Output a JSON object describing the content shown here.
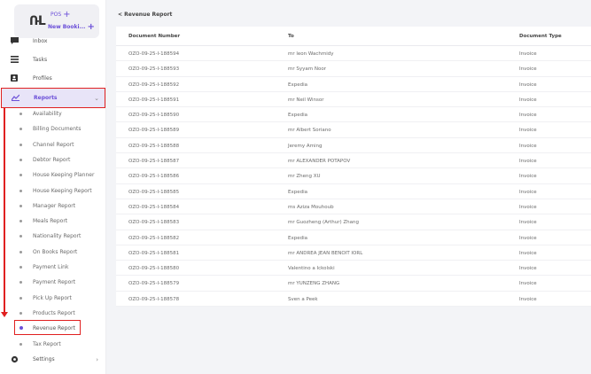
{
  "brand": {
    "logo": "ՌL",
    "line1": "POS",
    "line2": "New Booki..."
  },
  "sidebar": {
    "items": [
      {
        "label": "Inbox"
      },
      {
        "label": "Tasks"
      },
      {
        "label": "Profiles"
      },
      {
        "label": "Reports"
      }
    ],
    "reports_sub": [
      "Availability",
      "Billing Documents",
      "Channel Report",
      "Debtor Report",
      "House Keeping Planner",
      "House Keeping Report",
      "Manager Report",
      "Meals Report",
      "Nationality Report",
      "On Books Report",
      "Payment Link",
      "Payment Report",
      "Pick Up Report",
      "Products Report",
      "Revenue Report",
      "Tax Report"
    ],
    "settings": "Settings"
  },
  "main": {
    "breadcrumb": "< Revenue Report",
    "columns": [
      "Document Number",
      "To",
      "Document Type"
    ],
    "rows": [
      [
        "OZO-09-25-I-188594",
        "mr leon Wachmidy",
        "Invoice"
      ],
      [
        "OZO-09-25-I-188593",
        "mr Syyam Noor",
        "Invoice"
      ],
      [
        "OZO-09-25-I-188592",
        "Expedia",
        "Invoice"
      ],
      [
        "OZO-09-25-I-188591",
        "mr Neil Winsor",
        "Invoice"
      ],
      [
        "OZO-09-25-I-188590",
        "Expedia",
        "Invoice"
      ],
      [
        "OZO-09-25-I-188589",
        "mr Albert Soriano",
        "Invoice"
      ],
      [
        "OZO-09-25-I-188588",
        "Jeremy Aming",
        "Invoice"
      ],
      [
        "OZO-09-25-I-188587",
        "mr ALEXANDER POTAPOV",
        "Invoice"
      ],
      [
        "OZO-09-25-I-188586",
        "mr Zheng XU",
        "Invoice"
      ],
      [
        "OZO-09-25-I-188585",
        "Expedia",
        "Invoice"
      ],
      [
        "OZO-09-25-I-188584",
        "ms Aziza Mouhoub",
        "Invoice"
      ],
      [
        "OZO-09-25-I-188583",
        "mr Guozheng (Arthur) Zhang",
        "Invoice"
      ],
      [
        "OZO-09-25-I-188582",
        "Expedia",
        "Invoice"
      ],
      [
        "OZO-09-25-I-188581",
        "mr ANDREA JEAN BENOIT IORL",
        "Invoice"
      ],
      [
        "OZO-09-25-I-188580",
        "Valentino a Ickolski",
        "Invoice"
      ],
      [
        "OZO-09-25-I-188579",
        "mr YUNZENG ZHANG",
        "Invoice"
      ],
      [
        "OZO-09-25-I-188578",
        "Sven a Peek",
        "Invoice"
      ]
    ]
  },
  "colors": {
    "accent": "#6b4fd8",
    "highlight": "#e02020"
  }
}
